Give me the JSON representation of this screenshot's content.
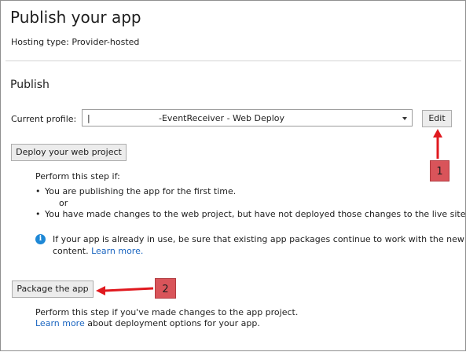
{
  "page": {
    "title": "Publish your app",
    "hosting_type": "Hosting type: Provider-hosted",
    "section_title": "Publish"
  },
  "profile": {
    "label": "Current profile:",
    "value_prefix": "|",
    "value_suffix": "-EventReceiver - Web Deploy",
    "edit_label": "Edit"
  },
  "deploy": {
    "button_label": "Deploy your web project",
    "intro": "Perform this step if:",
    "bullet_symbol": "•",
    "bullet1": "You are publishing the app for the first time.",
    "or": "or",
    "bullet2": "You have made changes to the web project, but have not deployed those changes to the live site yet.",
    "info_glyph": "i",
    "info_line1": "If your app is already in use, be sure that existing app packages continue to work with the new web",
    "info_line2": "content.",
    "info_link": "Learn more."
  },
  "package": {
    "button_label": "Package the app",
    "desc": "Perform this step if you've made changes to the app project.",
    "link": "Learn more",
    "link_suffix": " about deployment options for your app."
  },
  "callouts": {
    "one": "1",
    "two": "2",
    "color": "#d9545a",
    "arrow_color": "#e0191f"
  }
}
